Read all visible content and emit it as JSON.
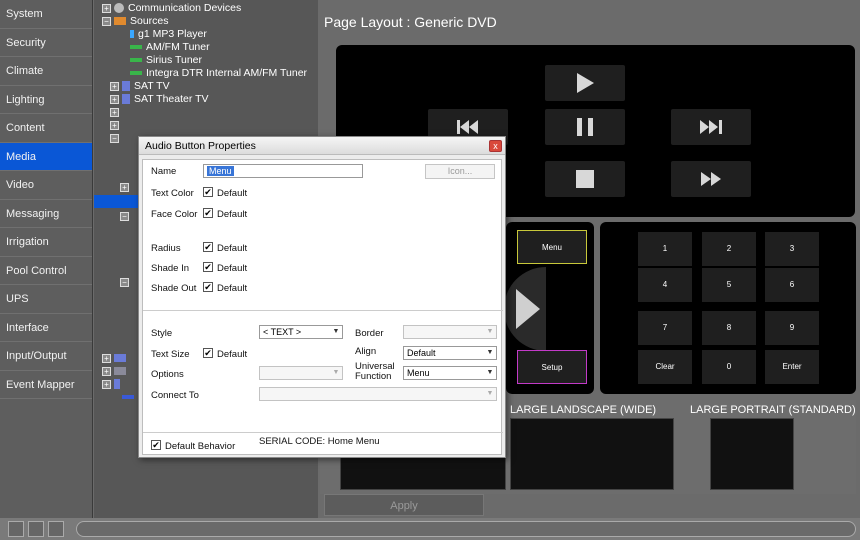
{
  "sidebar": {
    "items": [
      {
        "label": "System"
      },
      {
        "label": "Security"
      },
      {
        "label": "Climate"
      },
      {
        "label": "Lighting"
      },
      {
        "label": "Content"
      },
      {
        "label": "Media"
      },
      {
        "label": "Video"
      },
      {
        "label": "Messaging"
      },
      {
        "label": "Irrigation"
      },
      {
        "label": "Pool Control"
      },
      {
        "label": "UPS"
      },
      {
        "label": "Interface"
      },
      {
        "label": "Input/Output"
      },
      {
        "label": "Event Mapper"
      }
    ],
    "active_index": 5
  },
  "tree": {
    "communication_devices": "Communication Devices",
    "sources": "Sources",
    "mp3_player": "g1 MP3 Player",
    "am_fm_tuner": "AM/FM Tuner",
    "sirius_tuner": "Sirius Tuner",
    "integra_tuner": "Integra DTR Internal AM/FM Tuner",
    "sat_tv": "SAT TV",
    "sat_theater_tv": "SAT Theater TV",
    "expand_symbol": "+",
    "collapse_symbol": "−"
  },
  "main": {
    "page_title": "Page Layout : Generic DVD",
    "keypad": [
      "1",
      "2",
      "3",
      "4",
      "5",
      "6",
      "7",
      "8",
      "9",
      "Clear",
      "0",
      "Enter"
    ],
    "menu_button": "Menu",
    "setup_button": "Setup",
    "layouts": [
      "LARGE LANDSCAPE (WIDE)",
      "LARGE PORTRAIT (STANDARD)"
    ],
    "apply_button": "Apply"
  },
  "dialog": {
    "title": "Audio Button Properties",
    "close_symbol": "x",
    "name_label": "Name",
    "name_value": "Menu",
    "icon_button": "Icon...",
    "text_color_label": "Text Color",
    "face_color_label": "Face Color",
    "radius_label": "Radius",
    "shade_in_label": "Shade In",
    "shade_out_label": "Shade Out",
    "default_label": "Default",
    "style_label": "Style",
    "style_value": "< TEXT >",
    "border_label": "Border",
    "border_value": "",
    "text_size_label": "Text Size",
    "align_label": "Align",
    "align_value": "Default",
    "options_label": "Options",
    "options_value": "",
    "universal_function_label": "Universal Function",
    "universal_function_value": "Menu",
    "connect_to_label": "Connect To",
    "connect_to_value": "",
    "default_behavior_label": "Default Behavior",
    "serial_code": "SERIAL CODE: Home Menu",
    "check_mark": "✔"
  },
  "colors": {
    "accent": "#0a57d6",
    "menu_highlight": "#c8c83a",
    "setup_highlight": "#c23ac8"
  }
}
